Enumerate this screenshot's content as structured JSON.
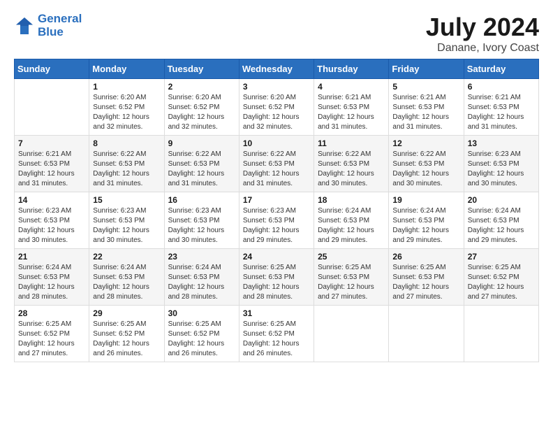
{
  "header": {
    "logo_line1": "General",
    "logo_line2": "Blue",
    "month": "July 2024",
    "location": "Danane, Ivory Coast"
  },
  "weekdays": [
    "Sunday",
    "Monday",
    "Tuesday",
    "Wednesday",
    "Thursday",
    "Friday",
    "Saturday"
  ],
  "weeks": [
    [
      {
        "day": "",
        "info": ""
      },
      {
        "day": "1",
        "info": "Sunrise: 6:20 AM\nSunset: 6:52 PM\nDaylight: 12 hours\nand 32 minutes."
      },
      {
        "day": "2",
        "info": "Sunrise: 6:20 AM\nSunset: 6:52 PM\nDaylight: 12 hours\nand 32 minutes."
      },
      {
        "day": "3",
        "info": "Sunrise: 6:20 AM\nSunset: 6:52 PM\nDaylight: 12 hours\nand 32 minutes."
      },
      {
        "day": "4",
        "info": "Sunrise: 6:21 AM\nSunset: 6:53 PM\nDaylight: 12 hours\nand 31 minutes."
      },
      {
        "day": "5",
        "info": "Sunrise: 6:21 AM\nSunset: 6:53 PM\nDaylight: 12 hours\nand 31 minutes."
      },
      {
        "day": "6",
        "info": "Sunrise: 6:21 AM\nSunset: 6:53 PM\nDaylight: 12 hours\nand 31 minutes."
      }
    ],
    [
      {
        "day": "7",
        "info": "Sunrise: 6:21 AM\nSunset: 6:53 PM\nDaylight: 12 hours\nand 31 minutes."
      },
      {
        "day": "8",
        "info": "Sunrise: 6:22 AM\nSunset: 6:53 PM\nDaylight: 12 hours\nand 31 minutes."
      },
      {
        "day": "9",
        "info": "Sunrise: 6:22 AM\nSunset: 6:53 PM\nDaylight: 12 hours\nand 31 minutes."
      },
      {
        "day": "10",
        "info": "Sunrise: 6:22 AM\nSunset: 6:53 PM\nDaylight: 12 hours\nand 31 minutes."
      },
      {
        "day": "11",
        "info": "Sunrise: 6:22 AM\nSunset: 6:53 PM\nDaylight: 12 hours\nand 30 minutes."
      },
      {
        "day": "12",
        "info": "Sunrise: 6:22 AM\nSunset: 6:53 PM\nDaylight: 12 hours\nand 30 minutes."
      },
      {
        "day": "13",
        "info": "Sunrise: 6:23 AM\nSunset: 6:53 PM\nDaylight: 12 hours\nand 30 minutes."
      }
    ],
    [
      {
        "day": "14",
        "info": "Sunrise: 6:23 AM\nSunset: 6:53 PM\nDaylight: 12 hours\nand 30 minutes."
      },
      {
        "day": "15",
        "info": "Sunrise: 6:23 AM\nSunset: 6:53 PM\nDaylight: 12 hours\nand 30 minutes."
      },
      {
        "day": "16",
        "info": "Sunrise: 6:23 AM\nSunset: 6:53 PM\nDaylight: 12 hours\nand 30 minutes."
      },
      {
        "day": "17",
        "info": "Sunrise: 6:23 AM\nSunset: 6:53 PM\nDaylight: 12 hours\nand 29 minutes."
      },
      {
        "day": "18",
        "info": "Sunrise: 6:24 AM\nSunset: 6:53 PM\nDaylight: 12 hours\nand 29 minutes."
      },
      {
        "day": "19",
        "info": "Sunrise: 6:24 AM\nSunset: 6:53 PM\nDaylight: 12 hours\nand 29 minutes."
      },
      {
        "day": "20",
        "info": "Sunrise: 6:24 AM\nSunset: 6:53 PM\nDaylight: 12 hours\nand 29 minutes."
      }
    ],
    [
      {
        "day": "21",
        "info": "Sunrise: 6:24 AM\nSunset: 6:53 PM\nDaylight: 12 hours\nand 28 minutes."
      },
      {
        "day": "22",
        "info": "Sunrise: 6:24 AM\nSunset: 6:53 PM\nDaylight: 12 hours\nand 28 minutes."
      },
      {
        "day": "23",
        "info": "Sunrise: 6:24 AM\nSunset: 6:53 PM\nDaylight: 12 hours\nand 28 minutes."
      },
      {
        "day": "24",
        "info": "Sunrise: 6:25 AM\nSunset: 6:53 PM\nDaylight: 12 hours\nand 28 minutes."
      },
      {
        "day": "25",
        "info": "Sunrise: 6:25 AM\nSunset: 6:53 PM\nDaylight: 12 hours\nand 27 minutes."
      },
      {
        "day": "26",
        "info": "Sunrise: 6:25 AM\nSunset: 6:53 PM\nDaylight: 12 hours\nand 27 minutes."
      },
      {
        "day": "27",
        "info": "Sunrise: 6:25 AM\nSunset: 6:52 PM\nDaylight: 12 hours\nand 27 minutes."
      }
    ],
    [
      {
        "day": "28",
        "info": "Sunrise: 6:25 AM\nSunset: 6:52 PM\nDaylight: 12 hours\nand 27 minutes."
      },
      {
        "day": "29",
        "info": "Sunrise: 6:25 AM\nSunset: 6:52 PM\nDaylight: 12 hours\nand 26 minutes."
      },
      {
        "day": "30",
        "info": "Sunrise: 6:25 AM\nSunset: 6:52 PM\nDaylight: 12 hours\nand 26 minutes."
      },
      {
        "day": "31",
        "info": "Sunrise: 6:25 AM\nSunset: 6:52 PM\nDaylight: 12 hours\nand 26 minutes."
      },
      {
        "day": "",
        "info": ""
      },
      {
        "day": "",
        "info": ""
      },
      {
        "day": "",
        "info": ""
      }
    ]
  ]
}
